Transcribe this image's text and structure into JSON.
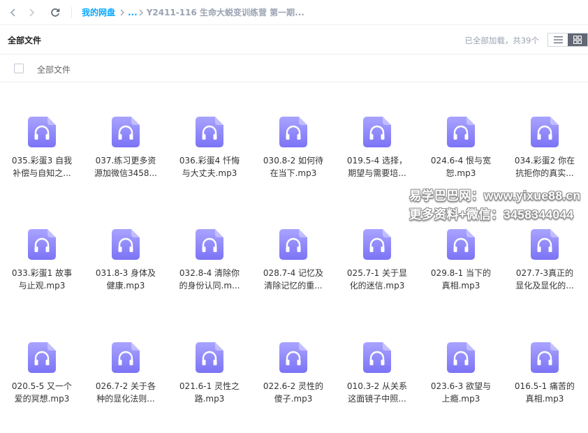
{
  "nav": {
    "back_icon": "chevron-left-icon",
    "forward_icon": "chevron-right-icon",
    "refresh_icon": "refresh-icon"
  },
  "breadcrumb": {
    "home": "我的网盘",
    "more": "...",
    "current": "Y2411-116 生命大蜕变训练营 第一期..."
  },
  "toolbar": {
    "title": "全部文件",
    "status": "已全部加载，共39个",
    "view_list_icon": "list-view-icon",
    "view_grid_icon": "grid-view-icon"
  },
  "list_header": {
    "column_name": "全部文件"
  },
  "colors": {
    "accent": "#06a7ff",
    "icon_gradient_top": "#a9a4ff",
    "icon_gradient_bottom": "#7b73f5"
  },
  "files": [
    {
      "name": "035.彩蛋3 自我\n补偿与自知之..."
    },
    {
      "name": "037.练习更多资\n源加微信3458..."
    },
    {
      "name": "036.彩蛋4 忏悔\n与大丈夫.mp3"
    },
    {
      "name": "030.8-2 如何待\n在当下.mp3"
    },
    {
      "name": "019.5-4 选择，\n期望与需要培..."
    },
    {
      "name": "024.6-4 恨与宽\n恕.mp3"
    },
    {
      "name": "034.彩蛋2 你在\n抗拒你的真实..."
    },
    {
      "name": "033.彩蛋1 故事\n与止观.mp3"
    },
    {
      "name": "031.8-3 身体及\n健康.mp3"
    },
    {
      "name": "032.8-4 清除你\n的身份认同.m..."
    },
    {
      "name": "028.7-4 记忆及\n清除记忆的重..."
    },
    {
      "name": "025.7-1 关于显\n化的迷信.mp3"
    },
    {
      "name": "029.8-1 当下的\n真相.mp3"
    },
    {
      "name": "027.7-3真正的\n显化及显化的..."
    },
    {
      "name": "020.5-5 又一个\n爱的冥想.mp3"
    },
    {
      "name": "026.7-2 关于各\n种的显化法则..."
    },
    {
      "name": "021.6-1 灵性之\n路.mp3"
    },
    {
      "name": "022.6-2 灵性的\n傻子.mp3"
    },
    {
      "name": "010.3-2 从关系\n这面镜子中照..."
    },
    {
      "name": "023.6-3 欲望与\n上瘾.mp3"
    },
    {
      "name": "016.5-1 痛苦的\n真相.mp3"
    }
  ],
  "file_icon": "audio-file-headphones-icon",
  "watermark": {
    "line1": "易学巴巴网：www.yixue88.cn",
    "line2": "更多资料+微信：3458344044"
  }
}
